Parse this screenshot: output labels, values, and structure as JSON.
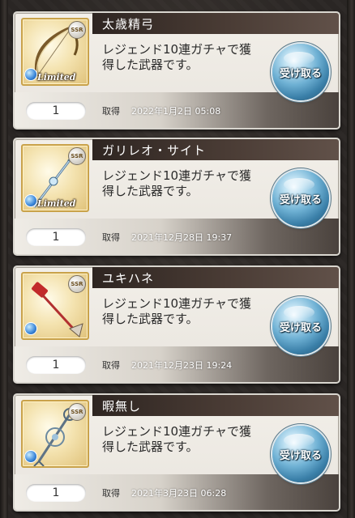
{
  "ssr_badge": "SSR",
  "limited_tag": "Limited",
  "acquired_label": "取得",
  "receive_label": "受け取る",
  "items": [
    {
      "name": "太歳精弓",
      "description_line1": "レジェンド10連ガチャで獲",
      "description_line2": "得した武器です。",
      "quantity": "1",
      "acquired_date": "2022年1月2日 05:08",
      "limited": true,
      "weapon_icon": "bow-icon"
    },
    {
      "name": "ガリレオ・サイト",
      "description_line1": "レジェンド10連ガチャで獲",
      "description_line2": "得した武器です。",
      "quantity": "1",
      "acquired_date": "2021年12月28日 19:37",
      "limited": true,
      "weapon_icon": "spear-icon"
    },
    {
      "name": "ユキハネ",
      "description_line1": "レジェンド10連ガチャで獲",
      "description_line2": "得した武器です。",
      "quantity": "1",
      "acquired_date": "2021年12月23日 19:24",
      "limited": false,
      "weapon_icon": "shovel-icon"
    },
    {
      "name": "暇無し",
      "description_line1": "レジェンド10連ガチャで獲",
      "description_line2": "得した武器です。",
      "quantity": "1",
      "acquired_date": "2021年3月23日 06:28",
      "limited": false,
      "weapon_icon": "ornate-staff-icon"
    }
  ]
}
